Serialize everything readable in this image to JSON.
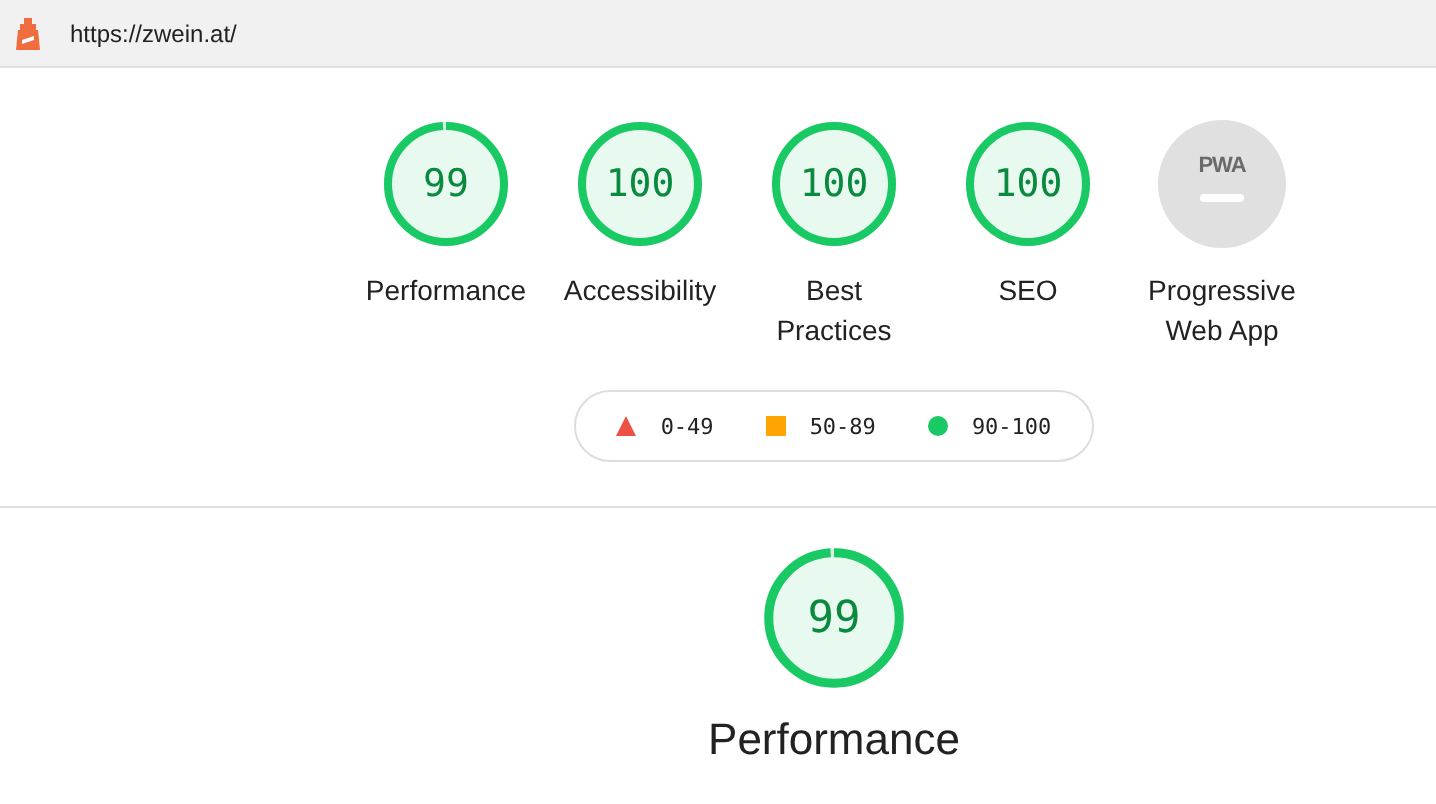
{
  "address_bar": {
    "url": "https://zwein.at/"
  },
  "gauges": [
    {
      "kind": "score",
      "score": "99",
      "level": 0.99,
      "label": "Performance"
    },
    {
      "kind": "score",
      "score": "100",
      "level": 1,
      "label": "Accessibility"
    },
    {
      "kind": "score",
      "score": "100",
      "level": 1,
      "label": "Best Practices"
    },
    {
      "kind": "score",
      "score": "100",
      "level": 1,
      "label": "SEO"
    },
    {
      "kind": "pwa",
      "badge": "PWA",
      "label": "Progressive Web App"
    }
  ],
  "legend": [
    {
      "kind": "fail",
      "range": "0-49",
      "color": "#eb5244"
    },
    {
      "kind": "average",
      "range": "50-89",
      "color": "#ffa400"
    },
    {
      "kind": "pass",
      "range": "90-100",
      "color": "#18c964"
    }
  ],
  "category": {
    "score": "99",
    "level": 0.99,
    "title": "Performance"
  }
}
